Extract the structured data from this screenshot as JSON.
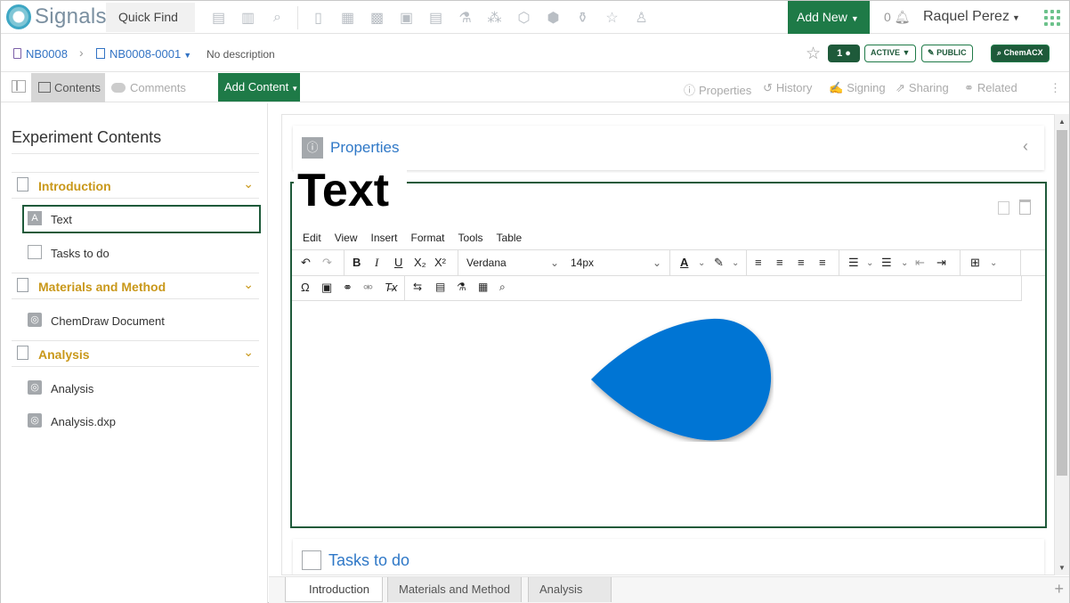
{
  "header": {
    "logo_text": "Signals",
    "quick_find": "Quick Find",
    "add_new": "Add New",
    "notification_count": "0",
    "user_name": "Raquel Perez"
  },
  "breadcrumb": {
    "notebook": "NB0008",
    "experiment": "NB0008-0001",
    "description": "No description"
  },
  "status": {
    "comment_count": "1",
    "state": "ACTIVE",
    "visibility": "PUBLIC",
    "chemacx": "ChemACX"
  },
  "viewbar": {
    "contents": "Contents",
    "comments": "Comments",
    "add_content": "Add Content",
    "properties": "Properties",
    "history": "History",
    "signing": "Signing",
    "sharing": "Sharing",
    "related": "Related"
  },
  "sidebar": {
    "title": "Experiment Contents",
    "sections": [
      {
        "label": "Introduction",
        "items": [
          {
            "label": "Text",
            "icon": "text-A"
          },
          {
            "label": "Tasks to do",
            "icon": "table"
          }
        ]
      },
      {
        "label": "Materials and Method",
        "items": [
          {
            "label": "ChemDraw Document",
            "icon": "chemdraw"
          }
        ]
      },
      {
        "label": "Analysis",
        "items": [
          {
            "label": "Analysis",
            "icon": "spectrus"
          },
          {
            "label": "Analysis.dxp",
            "icon": "spectrus"
          }
        ]
      }
    ]
  },
  "main": {
    "properties_title": "Properties",
    "text_heading": "Text",
    "menus": [
      "Edit",
      "View",
      "Insert",
      "Format",
      "Tools",
      "Table"
    ],
    "font_family": "Verdana",
    "font_size": "14px",
    "tasks_title": "Tasks to do",
    "drop_color": "#0675d4"
  },
  "bottom_tabs": [
    "Introduction",
    "Materials and Method",
    "Analysis"
  ],
  "colors": {
    "brand_green": "#1e7a47",
    "section_gold": "#c9981a",
    "link_blue": "#2f78c7"
  }
}
